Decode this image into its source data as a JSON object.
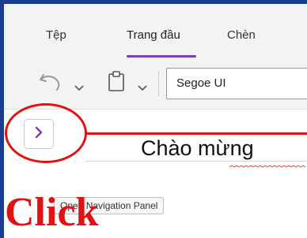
{
  "colors": {
    "accent": "#7b3fb5",
    "annotation": "#e11212",
    "frame": "#1a3d8f",
    "ribbon_bg": "#f3f3f3"
  },
  "ribbon": {
    "tabs": [
      {
        "label": "Tệp"
      },
      {
        "label": "Trang đầu",
        "active": true
      },
      {
        "label": "Chèn"
      }
    ],
    "toolbar": {
      "undo_icon": "undo-icon",
      "clipboard_icon": "clipboard-icon",
      "font_name": "Segoe UI"
    }
  },
  "page": {
    "title": "Chào mừng"
  },
  "nav_button": {
    "icon": "chevron-right-icon",
    "tooltip": "Open Navigation Panel"
  },
  "annotation": {
    "label": "Click"
  }
}
